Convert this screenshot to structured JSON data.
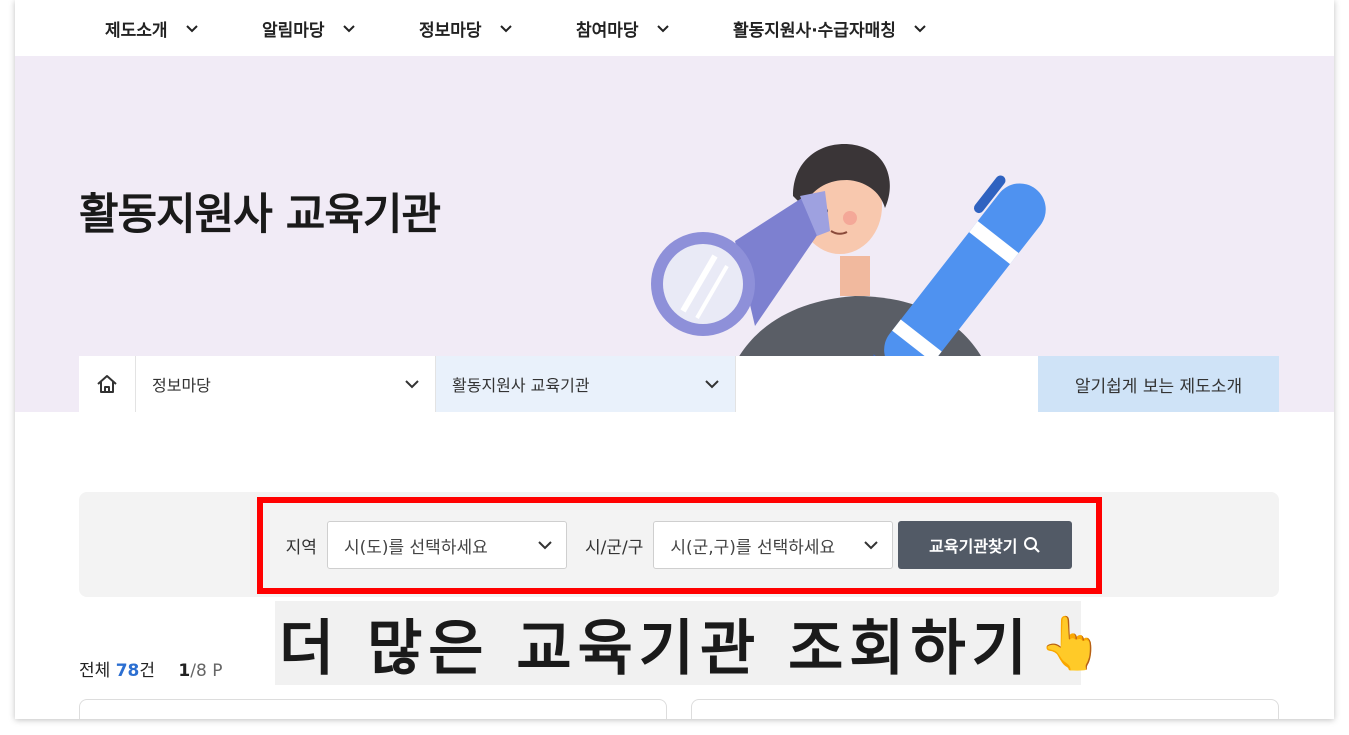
{
  "nav": {
    "items": [
      {
        "label": "제도소개"
      },
      {
        "label": "알림마당"
      },
      {
        "label": "정보마당"
      },
      {
        "label": "참여마당"
      },
      {
        "label": "활동지원사·수급자매칭"
      }
    ]
  },
  "hero": {
    "title": "활동지원사 교육기관"
  },
  "breadcrumb": {
    "level1": "정보마당",
    "level2": "활동지원사 교육기관",
    "intro_link": "알기쉽게 보는 제도소개"
  },
  "search": {
    "region_label": "지역",
    "region_placeholder": "시(도)를 선택하세요",
    "district_label": "시/군/구",
    "district_placeholder": "시(군,구)를 선택하세요",
    "button_label": "교육기관찾기"
  },
  "callout": {
    "text": "더 많은 교육기관 조회하기",
    "emoji": "👆"
  },
  "results": {
    "total_label": "전체",
    "total_count": "78",
    "count_unit": "건",
    "current_page": "1",
    "total_pages": "/8 P"
  },
  "colors": {
    "hero_bg": "#f1ebf6",
    "accent_blue": "#2c6fd1",
    "button_bg": "#525a66",
    "highlight": "#ff0000"
  }
}
